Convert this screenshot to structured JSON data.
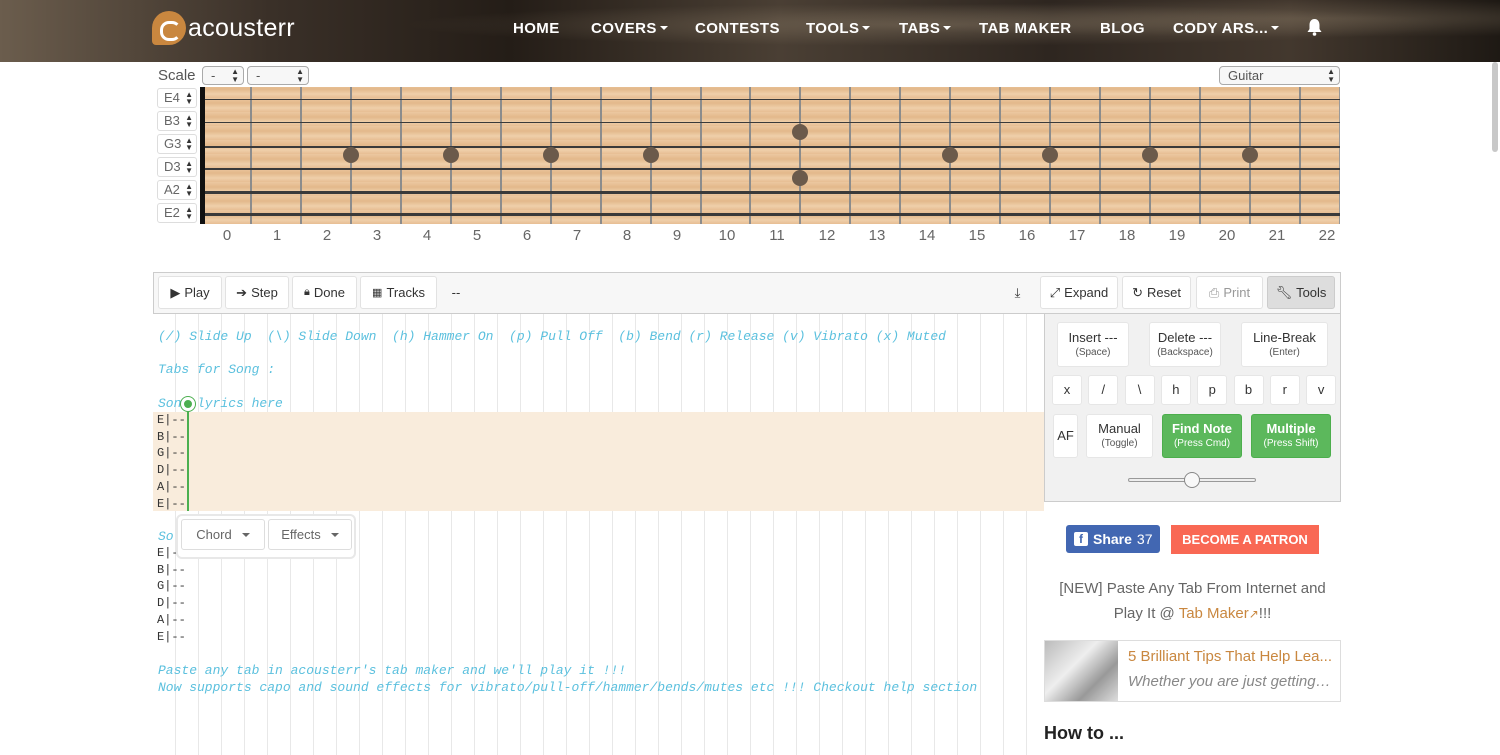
{
  "brand": {
    "name": "acousterr",
    "accent": "#c9873f"
  },
  "nav": {
    "items": [
      {
        "label": "HOME",
        "dropdown": false
      },
      {
        "label": "COVERS",
        "dropdown": true
      },
      {
        "label": "CONTESTS",
        "dropdown": false
      },
      {
        "label": "TOOLS",
        "dropdown": true
      },
      {
        "label": "TABS",
        "dropdown": true
      },
      {
        "label": "TAB MAKER",
        "dropdown": false
      },
      {
        "label": "BLOG",
        "dropdown": false
      },
      {
        "label": "CODY ARS...",
        "dropdown": true
      }
    ],
    "bell_icon": "bell-icon"
  },
  "scale": {
    "label": "Scale",
    "select1": "-",
    "select2": "-",
    "instrument": "Guitar"
  },
  "strings": [
    "E4",
    "B3",
    "G3",
    "D3",
    "A2",
    "E2"
  ],
  "frets": [
    "0",
    "1",
    "2",
    "3",
    "4",
    "5",
    "6",
    "7",
    "8",
    "9",
    "10",
    "11",
    "12",
    "13",
    "14",
    "15",
    "16",
    "17",
    "18",
    "19",
    "20",
    "21",
    "22"
  ],
  "toolbar": {
    "play": "Play",
    "step": "Step",
    "done": "Done",
    "tracks": "Tracks",
    "track_value": "--",
    "expand": "Expand",
    "reset": "Reset",
    "print": "Print",
    "tools": "Tools"
  },
  "editor": {
    "legend": "(/) Slide Up  (\\) Slide Down  (h) Hammer On  (p) Pull Off  (b) Bend (r) Release (v) Vibrato (x) Muted",
    "tabs_for_song": "Tabs for Song :",
    "song_lyrics_1": "Song lyrics here",
    "song_lyrics_2": "So",
    "tab_block_1": [
      "E|--",
      "B|--",
      "G|--",
      "D|--",
      "A|--",
      "E|--"
    ],
    "tab_block_2": [
      "E|--",
      "B|--",
      "G|--",
      "D|--",
      "A|--",
      "E|--"
    ],
    "footer_1": "Paste any tab in acousterr's tab maker and we'll play it !!!",
    "footer_2": "Now supports capo and sound effects for vibrato/pull-off/hammer/bends/mutes etc !!! Checkout help section",
    "popup": {
      "chord": "Chord",
      "effects": "Effects"
    }
  },
  "tools_panel": {
    "insert": {
      "label": "Insert ---",
      "hint": "(Space)"
    },
    "delete": {
      "label": "Delete ---",
      "hint": "(Backspace)"
    },
    "line_break": {
      "label": "Line-Break",
      "hint": "(Enter)"
    },
    "effects": [
      "x",
      "/",
      "\\",
      "h",
      "p",
      "b",
      "r",
      "v"
    ],
    "af": "AF",
    "manual": {
      "label": "Manual",
      "hint": "(Toggle)"
    },
    "find_note": {
      "label": "Find Note",
      "hint": "(Press Cmd)"
    },
    "multiple": {
      "label": "Multiple",
      "hint": "(Press Shift)"
    },
    "green": "#5cb85c"
  },
  "sidebar": {
    "share": {
      "label": "Share",
      "count": "37"
    },
    "patron": "BECOME A PATRON",
    "promo_1": "[NEW] Paste Any Tab From Internet and",
    "promo_2_pre": "Play It @ ",
    "promo_link": "Tab Maker",
    "promo_2_post": "!!!",
    "card_title": "5 Brilliant Tips That Help Lea...",
    "card_sub": "Whether you are just getting st...",
    "howto": "How to ..."
  }
}
